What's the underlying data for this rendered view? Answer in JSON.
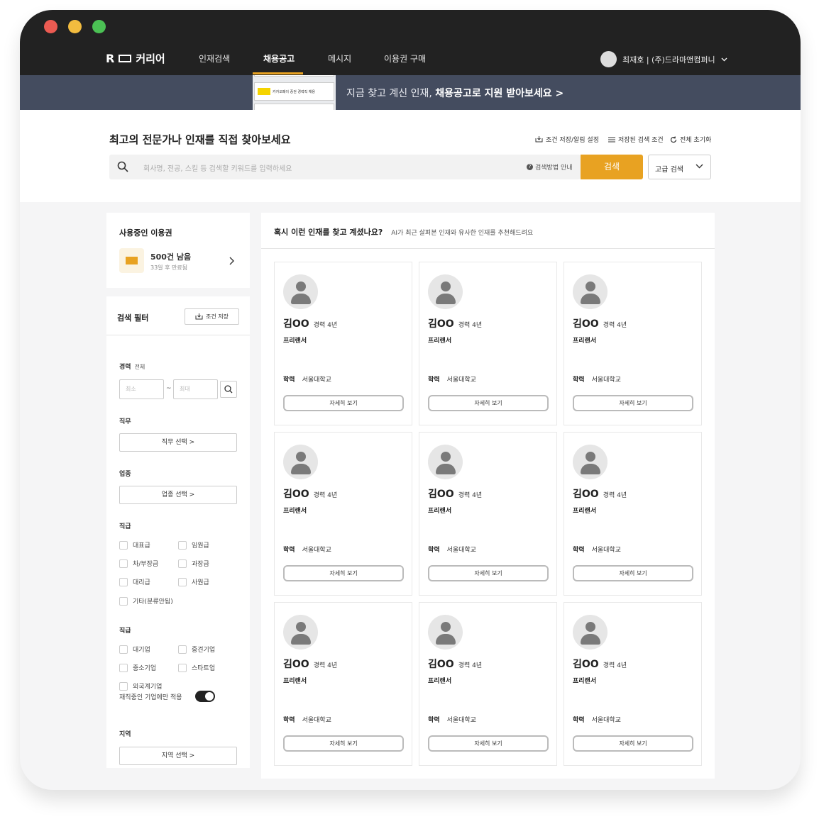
{
  "nav": {
    "logo": "커리어",
    "logo_r": "R",
    "items": [
      "인재검색",
      "채용공고",
      "메시지",
      "이용권 구매"
    ],
    "active_index": 1,
    "user": "최재호 | (주)드라마앤컴퍼니"
  },
  "banner": {
    "text_pre": "지금 찾고 계신 인재, ",
    "text_bold": "채용공고로 지원 받아보세요 >",
    "card_title": "카카오페이 증권 경력직 채용"
  },
  "search": {
    "title": "최고의 전문가나 인재를 직접 찾아보세요",
    "links": [
      "조건 저장/알림 설정",
      "저장된 검색 조건",
      "전체 초기화"
    ],
    "placeholder": "회사명, 전공, 스킬 등 검색할 키워드를 입력하세요",
    "help": "검색방법 안내",
    "button": "검색",
    "advanced": "고급 검색"
  },
  "ticket": {
    "title": "사용중인 이용권",
    "count": "500건 남음",
    "expires": "33일 후 만료됨"
  },
  "filter": {
    "title": "검색 필터",
    "save": "조건 저장",
    "career_label": "경력",
    "career_value": "전체",
    "min_placeholder": "최소",
    "max_placeholder": "최대",
    "tilde": "~",
    "job_label": "직무",
    "job_btn": "직무 선택  >",
    "industry_label": "업종",
    "industry_btn": "업종 선택  >",
    "rank_label": "직급",
    "ranks": [
      "대표급",
      "임원급",
      "차/부장급",
      "과장급",
      "대리급",
      "사원급",
      "기타(분류안됨)"
    ],
    "size_label": "직급",
    "sizes": [
      "대기업",
      "중견기업",
      "중소기업",
      "스타트업",
      "외국계기업"
    ],
    "toggle_label": "재직중인 기업에만 적용",
    "toggle_on": true,
    "region_label": "지역",
    "region_btn": "지역 선택  >"
  },
  "main": {
    "title": "혹시 이런 인재를 찾고 계셨나요?",
    "subtitle": "AI가 최근 살펴본 인재와 유사한 인재를 추천해드려요"
  },
  "cards": [
    {
      "name": "김OO",
      "exp": "경력 4년",
      "type": "프리랜서",
      "edu_label": "학력",
      "edu": "서울대학교",
      "btn": "자세히 보기"
    },
    {
      "name": "김OO",
      "exp": "경력 4년",
      "type": "프리랜서",
      "edu_label": "학력",
      "edu": "서울대학교",
      "btn": "자세히 보기"
    },
    {
      "name": "김OO",
      "exp": "경력 4년",
      "type": "프리랜서",
      "edu_label": "학력",
      "edu": "서울대학교",
      "btn": "자세히 보기"
    },
    {
      "name": "김OO",
      "exp": "경력 4년",
      "type": "프리랜서",
      "edu_label": "학력",
      "edu": "서울대학교",
      "btn": "자세히 보기"
    },
    {
      "name": "김OO",
      "exp": "경력 4년",
      "type": "프리랜서",
      "edu_label": "학력",
      "edu": "서울대학교",
      "btn": "자세히 보기"
    },
    {
      "name": "김OO",
      "exp": "경력 4년",
      "type": "프리랜서",
      "edu_label": "학력",
      "edu": "서울대학교",
      "btn": "자세히 보기"
    },
    {
      "name": "김OO",
      "exp": "경력 4년",
      "type": "프리랜서",
      "edu_label": "학력",
      "edu": "서울대학교",
      "btn": "자세히 보기"
    },
    {
      "name": "김OO",
      "exp": "경력 4년",
      "type": "프리랜서",
      "edu_label": "학력",
      "edu": "서울대학교",
      "btn": "자세히 보기"
    },
    {
      "name": "김OO",
      "exp": "경력 4년",
      "type": "프리랜서",
      "edu_label": "학력",
      "edu": "서울대학교",
      "btn": "자세히 보기"
    }
  ],
  "colors": {
    "accent": "#e8a222",
    "chrome": "#222222",
    "banner": "#444c5f"
  }
}
